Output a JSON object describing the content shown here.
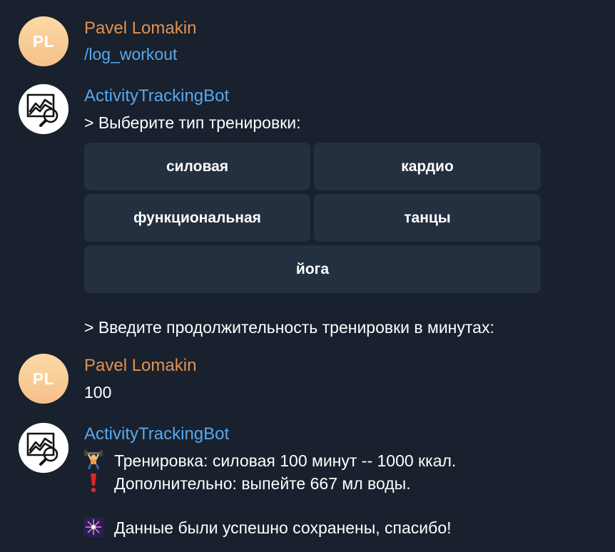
{
  "messages": [
    {
      "sender": "Pavel Lomakin",
      "avatar_initials": "PL",
      "text": "/log_workout"
    },
    {
      "sender": "ActivityTrackingBot",
      "text": "> Выберите тип тренировки:",
      "keyboard": [
        "силовая",
        "кардио",
        "функциональная",
        "танцы",
        "йога"
      ]
    },
    {
      "text": "> Введите продолжительность тренировки в минутах:"
    },
    {
      "sender": "Pavel Lomakin",
      "avatar_initials": "PL",
      "text": "100"
    },
    {
      "sender": "ActivityTrackingBot",
      "lines": [
        {
          "emoji": "weightlifter-icon",
          "text": "Тренировка: силовая 100 минут -- 1000 ккал."
        },
        {
          "emoji": "exclamation-icon",
          "text": "Дополнительно: выпейте 667 мл воды."
        },
        {
          "emoji": "sparkler-icon",
          "text": "Данные были успешно сохранены, спасибо!"
        }
      ]
    }
  ],
  "colors": {
    "background": "#18212d",
    "user_name": "#e39152",
    "bot_name": "#5aa7ec",
    "command": "#5aa7ec",
    "keyboard_button": "#242f40"
  }
}
